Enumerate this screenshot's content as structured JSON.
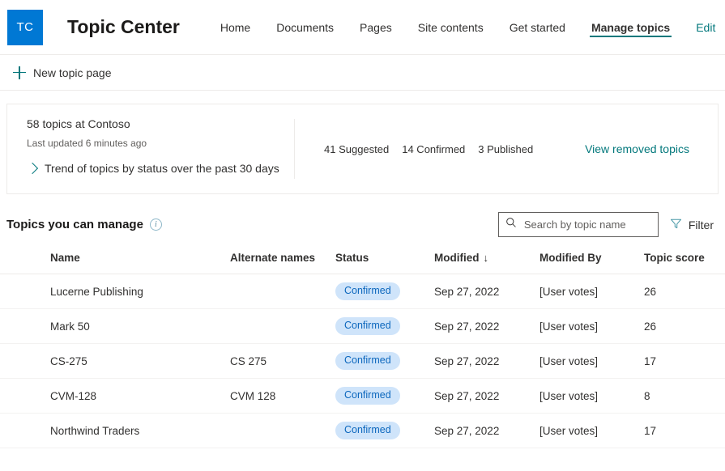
{
  "header": {
    "logo_initials": "TC",
    "site_title": "Topic Center",
    "nav": [
      {
        "label": "Home",
        "selected": false
      },
      {
        "label": "Documents",
        "selected": false
      },
      {
        "label": "Pages",
        "selected": false
      },
      {
        "label": "Site contents",
        "selected": false
      },
      {
        "label": "Get started",
        "selected": false
      },
      {
        "label": "Manage topics",
        "selected": true
      },
      {
        "label": "Edit",
        "selected": false
      }
    ],
    "accent_teal": "#03787c",
    "logo_blue": "#0078d4"
  },
  "command_bar": {
    "new_topic_page": "New topic page"
  },
  "summary": {
    "topic_count_text": "58 topics at Contoso",
    "last_updated": "Last updated 6 minutes ago",
    "trend_label": "Trend of topics by status over the past 30 days",
    "stats": [
      "41 Suggested",
      "14 Confirmed",
      "3 Published"
    ],
    "view_removed": "View removed topics"
  },
  "list": {
    "title": "Topics you can manage",
    "info_glyph": "i",
    "search_placeholder": "Search by topic name",
    "search_value": "",
    "filter_label": "Filter",
    "columns": [
      "Name",
      "Alternate names",
      "Status",
      "Modified",
      "Modified By",
      "Topic score"
    ],
    "sort_column": "Modified",
    "sort_arrow": "↓",
    "rows": [
      {
        "name": "Lucerne Publishing",
        "alternate": "",
        "status": "Confirmed",
        "modified": "Sep 27, 2022",
        "modified_by": "[User votes]",
        "score": "26"
      },
      {
        "name": "Mark 50",
        "alternate": "",
        "status": "Confirmed",
        "modified": "Sep 27, 2022",
        "modified_by": "[User votes]",
        "score": "26"
      },
      {
        "name": "CS-275",
        "alternate": "CS 275",
        "status": "Confirmed",
        "modified": "Sep 27, 2022",
        "modified_by": "[User votes]",
        "score": "17"
      },
      {
        "name": "CVM-128",
        "alternate": "CVM 128",
        "status": "Confirmed",
        "modified": "Sep 27, 2022",
        "modified_by": "[User votes]",
        "score": "8"
      },
      {
        "name": "Northwind Traders",
        "alternate": "",
        "status": "Confirmed",
        "modified": "Sep 27, 2022",
        "modified_by": "[User votes]",
        "score": "17"
      }
    ],
    "badge_bg": "#cfe4fa",
    "badge_fg": "#0c67bd"
  }
}
